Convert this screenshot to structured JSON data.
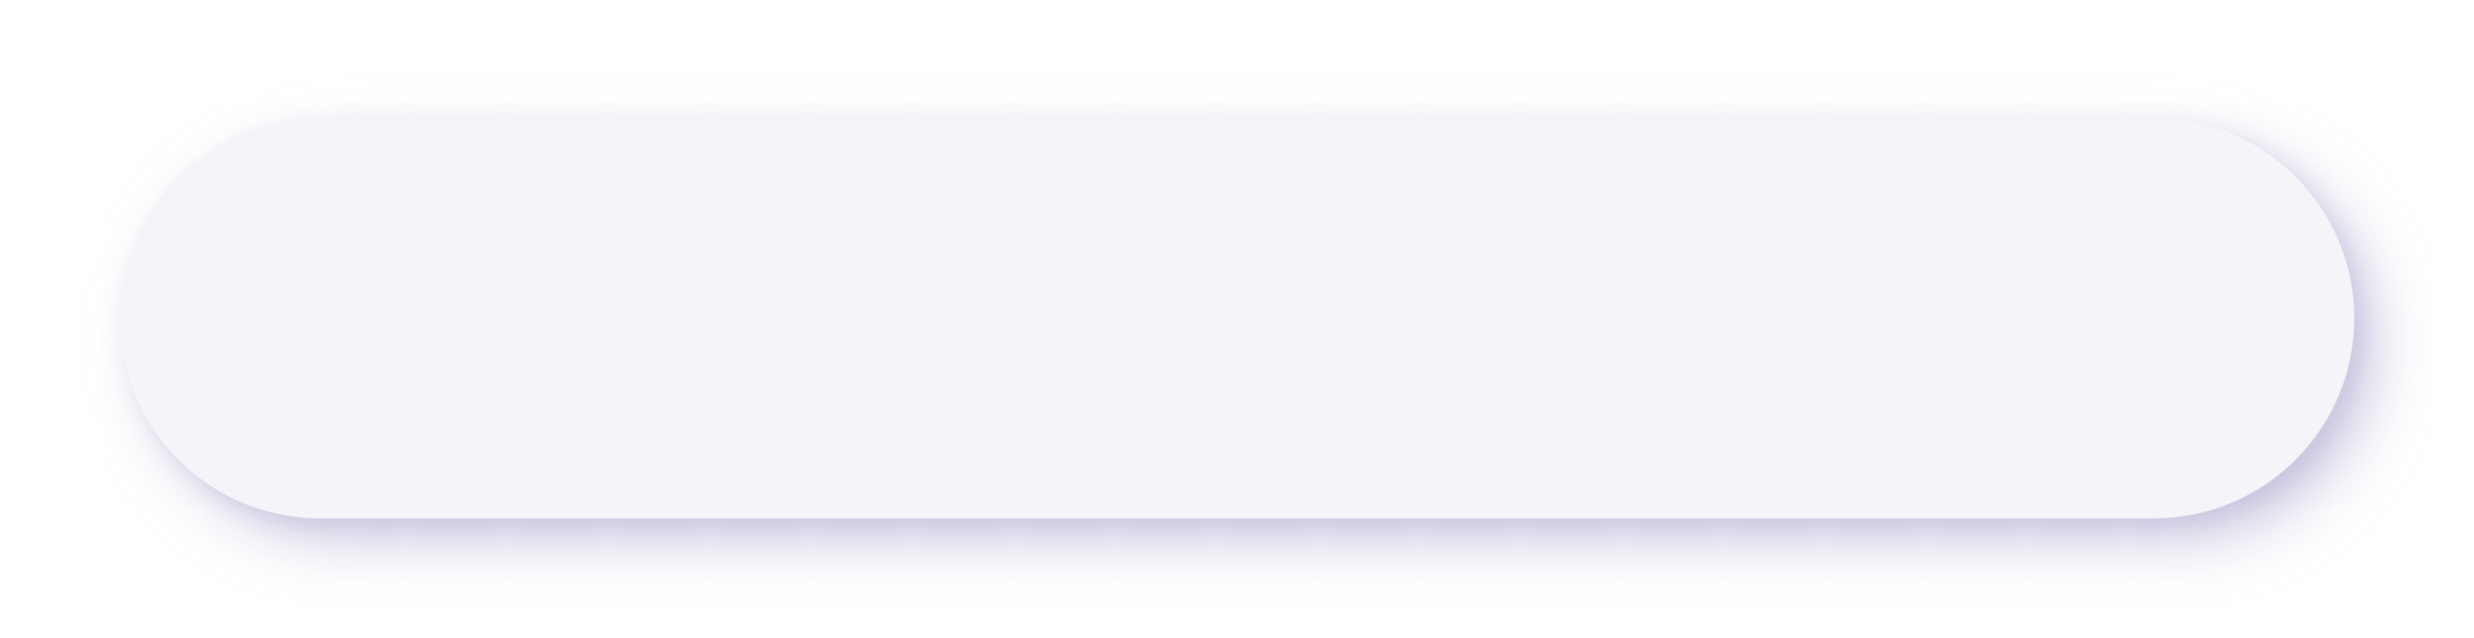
{
  "pill": {
    "label": ""
  },
  "colors": {
    "background": "#ffffff",
    "surface": "#f5f4f9",
    "shadow": "#aaa6cd",
    "highlight": "#ffffff"
  }
}
